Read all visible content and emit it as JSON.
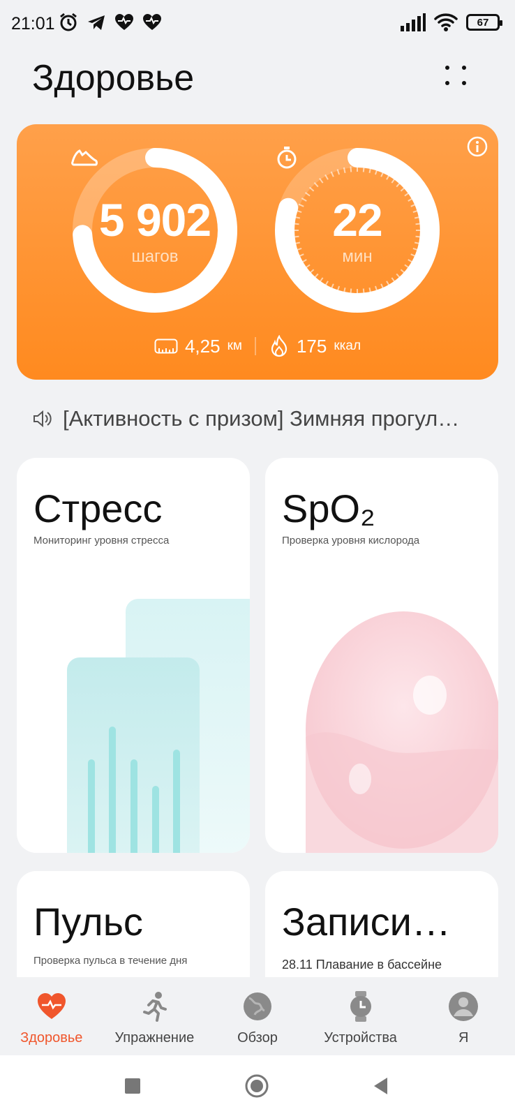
{
  "status_bar": {
    "time": "21:01",
    "battery": "67"
  },
  "header": {
    "title": "Здоровье"
  },
  "activity": {
    "steps": {
      "value": "5 902",
      "unit": "шагов",
      "progress": 0.74
    },
    "minutes": {
      "value": "22",
      "unit": "мин",
      "progress": 0.8
    },
    "distance": {
      "value": "4,25",
      "unit": "км"
    },
    "calories": {
      "value": "175",
      "unit": "ккал"
    }
  },
  "promo": {
    "text": "[Активность с призом] Зимняя прогул…"
  },
  "cards": {
    "stress": {
      "title": "Стресс",
      "subtitle": "Мониторинг уровня стресса"
    },
    "spo2": {
      "title": "SpO₂",
      "subtitle": "Проверка уровня кислорода"
    },
    "pulse": {
      "title": "Пульс",
      "subtitle": "Проверка пульса в течение дня"
    },
    "records": {
      "title": "Записи…",
      "subtitle": "28.11  Плавание в бассейне"
    }
  },
  "tabs": [
    {
      "label": "Здоровье",
      "icon": "heart-icon",
      "active": true
    },
    {
      "label": "Упражнение",
      "icon": "running-icon"
    },
    {
      "label": "Обзор",
      "icon": "globe-icon"
    },
    {
      "label": "Устройства",
      "icon": "watch-icon"
    },
    {
      "label": "Я",
      "icon": "profile-icon"
    }
  ],
  "colors": {
    "accent": "#f0562c",
    "activity_card": "#ff9330",
    "stress_bars": "#9ee3e2",
    "spo2_blob": "#f8c8cf"
  }
}
